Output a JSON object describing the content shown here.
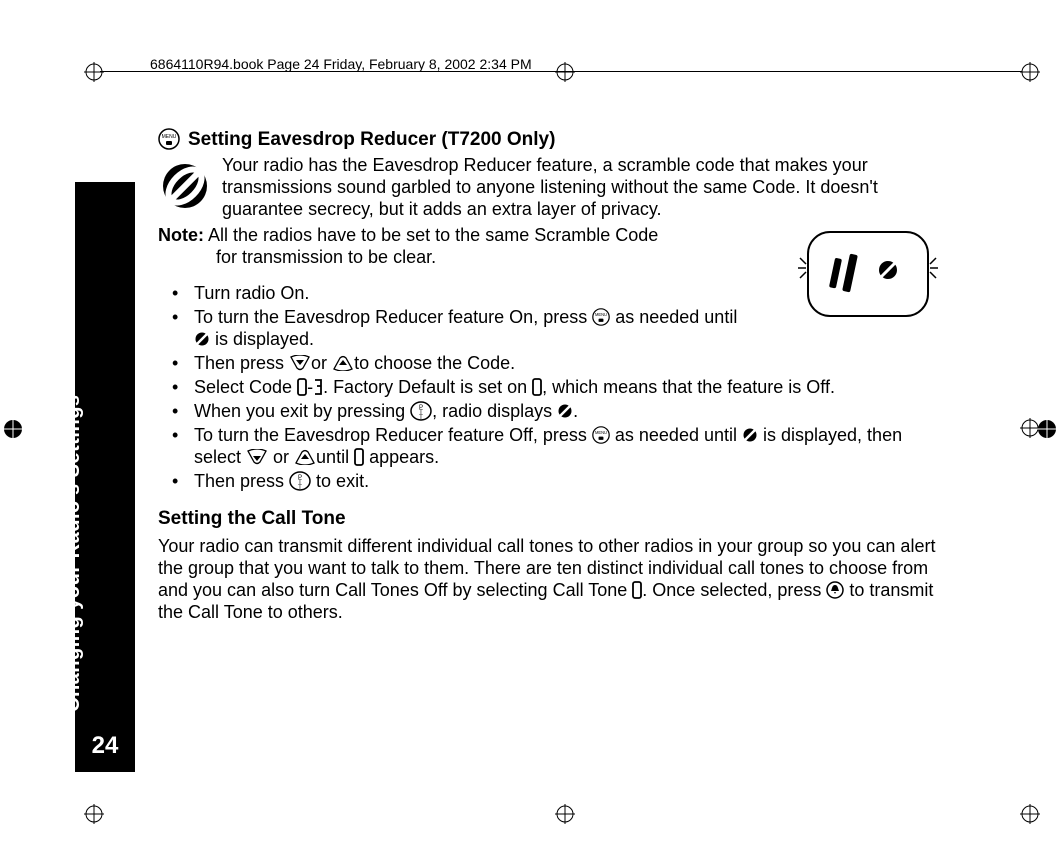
{
  "header": {
    "running_head": "6864110R94.book  Page 24  Friday, February 8, 2002  2:34 PM"
  },
  "sidebar": {
    "section_label": "Changing your Radio's Settings",
    "page_number": "24"
  },
  "section1": {
    "title": "Setting Eavesdrop Reducer (T7200 Only)",
    "intro": "Your radio has the Eavesdrop Reducer feature, a scramble code that makes your transmissions sound garbled to anyone listening without the same Code. It doesn't guarantee secrecy, but it adds an extra layer of privacy.",
    "note_label": "Note:",
    "note_text_line1": "All the radios have to be set to the same Scramble Code",
    "note_text_line2": "for transmission to be clear.",
    "steps": {
      "s1": "Turn radio On.",
      "s2a": "To turn the Eavesdrop Reducer feature On, press ",
      "s2b": " as needed until ",
      "s2c": " is displayed.",
      "s3a": "Then press ",
      "s3b": "or ",
      "s3c": "to choose the Code.",
      "s4a": "Select Code ",
      "s4b": "-",
      "s4c": ". Factory Default is set on ",
      "s4d": ", which means that the feature is Off.",
      "s5a": "When you exit by pressing  ",
      "s5b": ", radio displays ",
      "s5c": ".",
      "s6a": "To turn the Eavesdrop Reducer feature Off, press ",
      "s6b": " as needed until ",
      "s6c": " is displayed, then select  ",
      "s6d": " or ",
      "s6e": "until ",
      "s6f": " appears.",
      "s7a": "Then press  ",
      "s7b": " to exit."
    }
  },
  "section2": {
    "title": "Setting the Call Tone",
    "body_a": "Your radio can transmit different individual call tones to other radios in your group so you can alert the group that you want to talk to them. There are ten distinct individual call tones to choose from and you can also turn Call Tones Off by selecting Call Tone ",
    "body_b": ". Once selected, press ",
    "body_c": " to transmit the Call Tone to others."
  },
  "icons": {
    "menu": "menu-icon",
    "scramble": "scramble-icon",
    "up": "up-arrow-icon",
    "down": "down-arrow-icon",
    "ptt": "ptt-button-icon",
    "digit0": "digit-0-glyph",
    "digit3": "digit-3-glyph",
    "bell": "bell-icon",
    "noscramble": "no-scramble-icon"
  }
}
